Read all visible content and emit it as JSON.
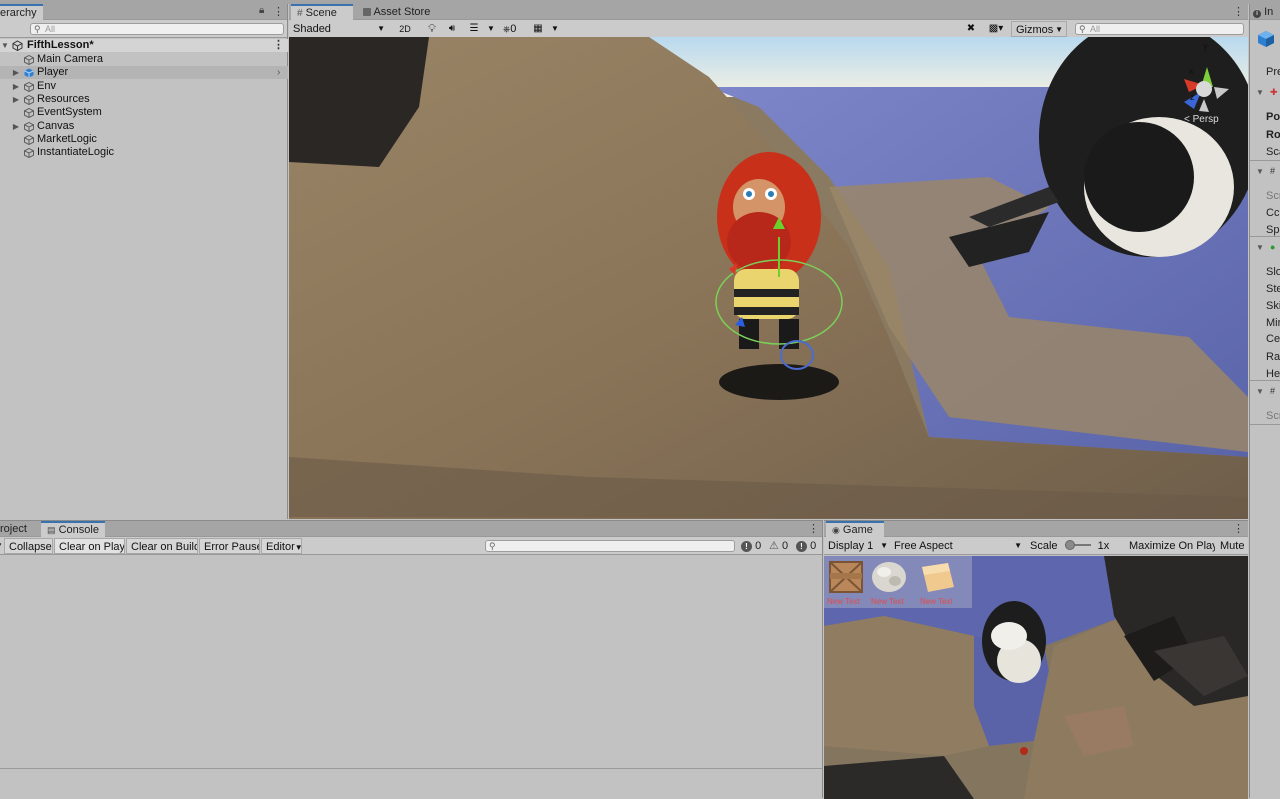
{
  "hierarchy": {
    "tab_label": "erarchy",
    "search_placeholder": "All",
    "scene_name": "FifthLesson*",
    "items": [
      {
        "label": "Main Camera",
        "has_children": false,
        "selected": false
      },
      {
        "label": "Player",
        "has_children": true,
        "selected": true
      },
      {
        "label": "Env",
        "has_children": true,
        "selected": false
      },
      {
        "label": "Resources",
        "has_children": true,
        "selected": false
      },
      {
        "label": "EventSystem",
        "has_children": false,
        "selected": false
      },
      {
        "label": "Canvas",
        "has_children": true,
        "selected": false
      },
      {
        "label": "MarketLogic",
        "has_children": false,
        "selected": false
      },
      {
        "label": "InstantiateLogic",
        "has_children": false,
        "selected": false
      }
    ]
  },
  "scene": {
    "tabs": [
      {
        "label": "Scene",
        "icon": "hash-icon",
        "active": true
      },
      {
        "label": "Asset Store",
        "icon": "store-icon",
        "active": false
      }
    ],
    "shading_mode": "Shaded",
    "mode_2d": "2D",
    "hidden_count": "0",
    "gizmos_label": "Gizmos",
    "search_placeholder": "All",
    "persp_label": "< Persp",
    "axis_labels": {
      "x": "x",
      "y": "y",
      "z": "z"
    }
  },
  "inspector": {
    "tab_label": "In",
    "prefab_label": "Pref",
    "rows": [
      "Pos",
      "Rot",
      "Sca",
      "Scr",
      "Cc",
      "Spe",
      "Slo",
      "Ste",
      "Ski",
      "Mir",
      "Cer",
      "Rad",
      "Hei",
      "Scr"
    ]
  },
  "console": {
    "tabs": [
      {
        "label": "roject",
        "active": false
      },
      {
        "label": "Console",
        "active": true
      }
    ],
    "buttons": [
      "Collapse",
      "Clear on Play",
      "Clear on Build",
      "Error Pause",
      "Editor"
    ],
    "counts": {
      "log": "0",
      "warning": "0",
      "error": "0"
    }
  },
  "game": {
    "tab_label": "Game",
    "display": "Display 1",
    "aspect": "Free Aspect",
    "scale_label": "Scale",
    "scale_value": "1x",
    "maximize_label": "Maximize On Play",
    "mute_label": "Mute",
    "ui_items": [
      {
        "label": "New Text",
        "icon": "wood-crate-icon"
      },
      {
        "label": "New Text",
        "icon": "stone-icon"
      },
      {
        "label": "New Text",
        "icon": "sand-block-icon"
      }
    ]
  },
  "colors": {
    "accent": "#3a72b0",
    "panel": "#c2c2c2",
    "ui_label_red": "#e24c4c"
  }
}
